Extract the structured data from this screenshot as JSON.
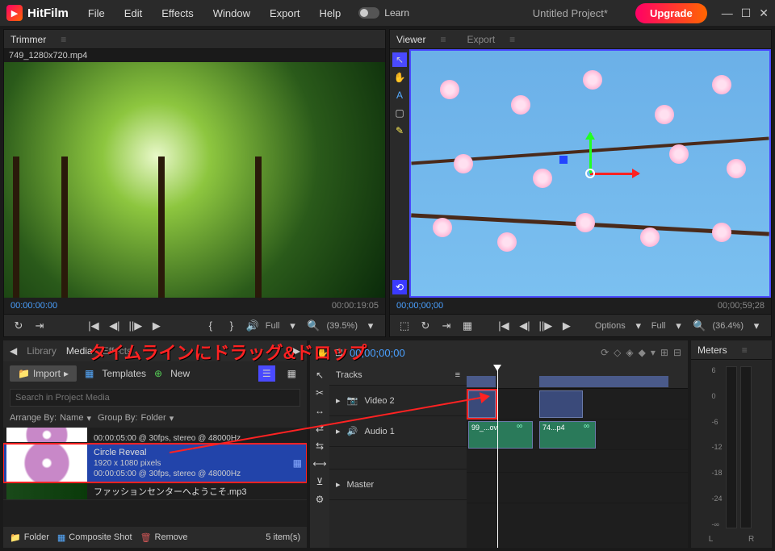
{
  "app": {
    "name": "HitFilm",
    "project_title": "Untitled Project*",
    "upgrade": "Upgrade"
  },
  "menu": {
    "file": "File",
    "edit": "Edit",
    "effects": "Effects",
    "window": "Window",
    "export": "Export",
    "help": "Help",
    "learn": "Learn"
  },
  "trimmer": {
    "tab": "Trimmer",
    "clip_name": "749_1280x720.mp4",
    "tc_left": "00:00:00:00",
    "tc_right": "00:00:19:05",
    "full": "Full",
    "zoom": "(39.5%)"
  },
  "viewer": {
    "tab_viewer": "Viewer",
    "tab_export": "Export",
    "tc_left": "00;00;00;00",
    "tc_right": "00;00;59;28",
    "options": "Options",
    "full": "Full",
    "zoom": "(36.4%)"
  },
  "media": {
    "tab_library": "Library",
    "tab_media": "Media",
    "tab_effects": "Effects",
    "import": "Import",
    "templates": "Templates",
    "new": "New",
    "search_placeholder": "Search in Project Media",
    "arrange_by": "Arrange By:",
    "arrange_val": "Name",
    "group_by": "Group By:",
    "group_val": "Folder",
    "item0_meta": "00:00:05:00 @ 30fps, stereo @ 48000Hz",
    "item1_title": "Circle Reveal",
    "item1_res": "1920 x 1080 pixels",
    "item1_meta": "00:00:05:00 @ 30fps, stereo @ 48000Hz",
    "item2_title": "ファッションセンターへようこそ.mp3",
    "footer_folder": "Folder",
    "footer_comp": "Composite Shot",
    "footer_remove": "Remove",
    "footer_count": "5 item(s)"
  },
  "timeline": {
    "tc": "00;00;00;00",
    "tracks_label": "Tracks",
    "track_video2": "Video 2",
    "track_audio1": "Audio 1",
    "track_master": "Master",
    "clip_a": "99_...ov",
    "clip_b": "74...p4"
  },
  "meters": {
    "tab": "Meters",
    "scale": [
      "6",
      "0",
      "-6",
      "-12",
      "-18",
      "-24",
      "-∞"
    ],
    "L": "L",
    "R": "R"
  },
  "annotation": {
    "text": "タイムラインにドラッグ&ドロップ"
  }
}
